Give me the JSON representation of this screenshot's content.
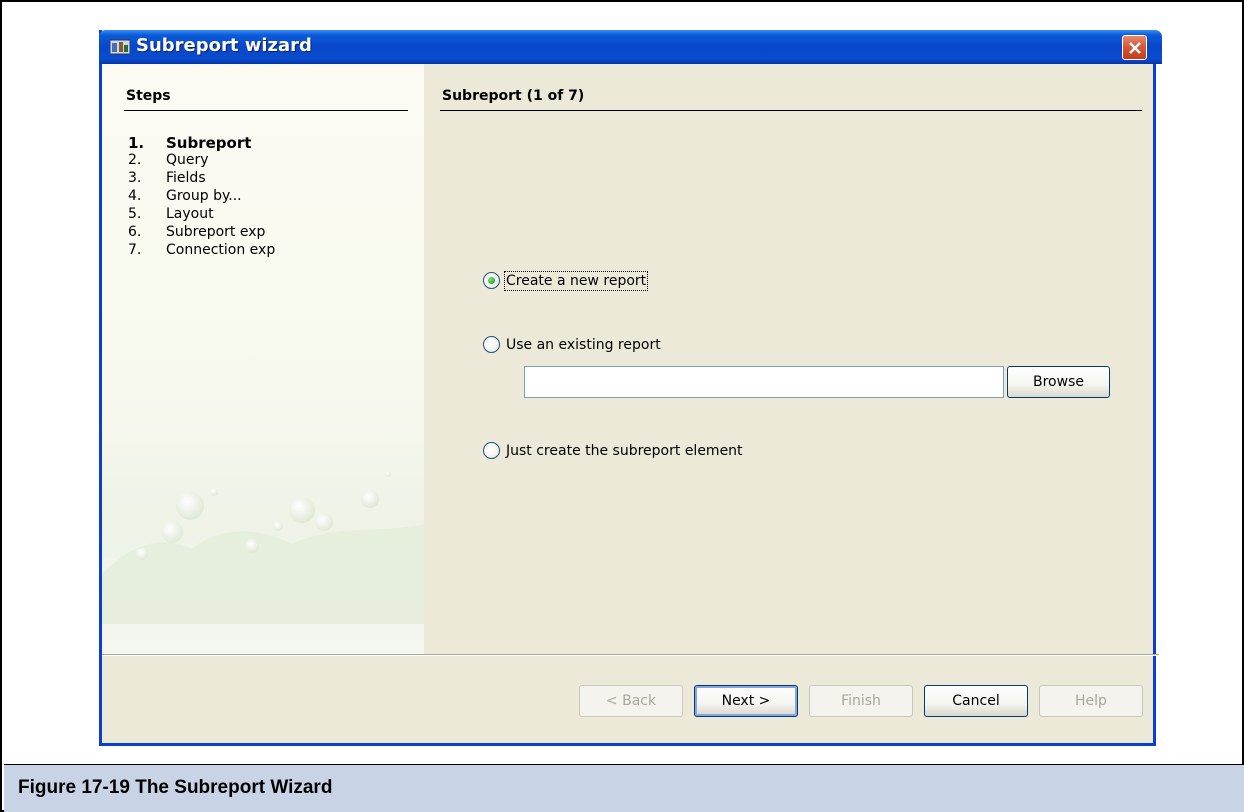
{
  "window": {
    "title": "Subreport wizard",
    "icon": "wizard-app-icon",
    "close_icon": "close-icon"
  },
  "steps": {
    "heading": "Steps",
    "items": [
      {
        "num": "1.",
        "label": "Subreport",
        "active": true
      },
      {
        "num": "2.",
        "label": "Query"
      },
      {
        "num": "3.",
        "label": "Fields"
      },
      {
        "num": "4.",
        "label": "Group by..."
      },
      {
        "num": "5.",
        "label": "Layout"
      },
      {
        "num": "6.",
        "label": "Subreport exp"
      },
      {
        "num": "7.",
        "label": "Connection exp"
      }
    ]
  },
  "content": {
    "heading": "Subreport (1 of 7)",
    "options": [
      {
        "label": "Create a new report",
        "checked": true
      },
      {
        "label": "Use an existing report",
        "checked": false
      },
      {
        "label": "Just create the subreport element",
        "checked": false
      }
    ],
    "path_value": "",
    "browse_label": "Browse"
  },
  "buttons": {
    "back": "< Back",
    "next": "Next >",
    "finish": "Finish",
    "cancel": "Cancel",
    "help": "Help"
  },
  "caption": {
    "text": "Figure 17-19  The Subreport Wizard"
  },
  "colors": {
    "titlebar": "#0846c9",
    "dialog_bg": "#ece9d8",
    "caption_bg": "#c8d3e6",
    "radio_checked": "#2fa82f"
  }
}
